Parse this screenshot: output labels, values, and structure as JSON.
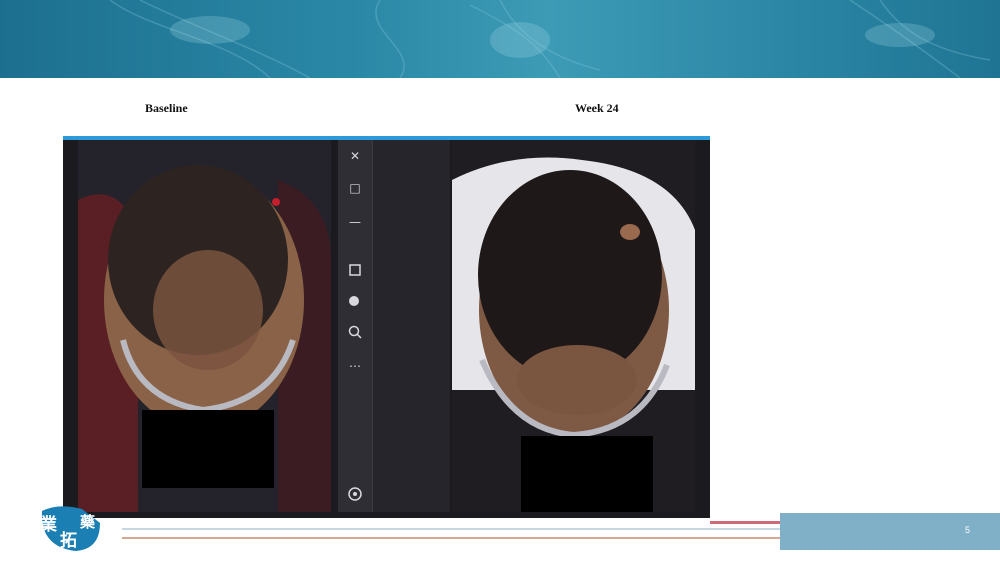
{
  "slide": {
    "baseline_label": "Baseline",
    "week_label": "Week 24",
    "page_number": "5"
  },
  "viewer": {
    "tools": [
      "close-icon",
      "maximize-icon",
      "minimize-icon",
      "crop-icon",
      "zoom-in-icon",
      "zoom-out-icon",
      "more-icon",
      "info-icon"
    ],
    "close_glyph": "✕",
    "maximize_glyph": "□",
    "minimize_glyph": "—",
    "more_glyph": "⋯"
  },
  "logo": {
    "char_1": "業",
    "char_2": "拓",
    "char_3": "藥"
  },
  "colors": {
    "banner": "#2a88a6",
    "frame_accent": "#2c9ad9",
    "page_box": "#7fb0c8"
  }
}
